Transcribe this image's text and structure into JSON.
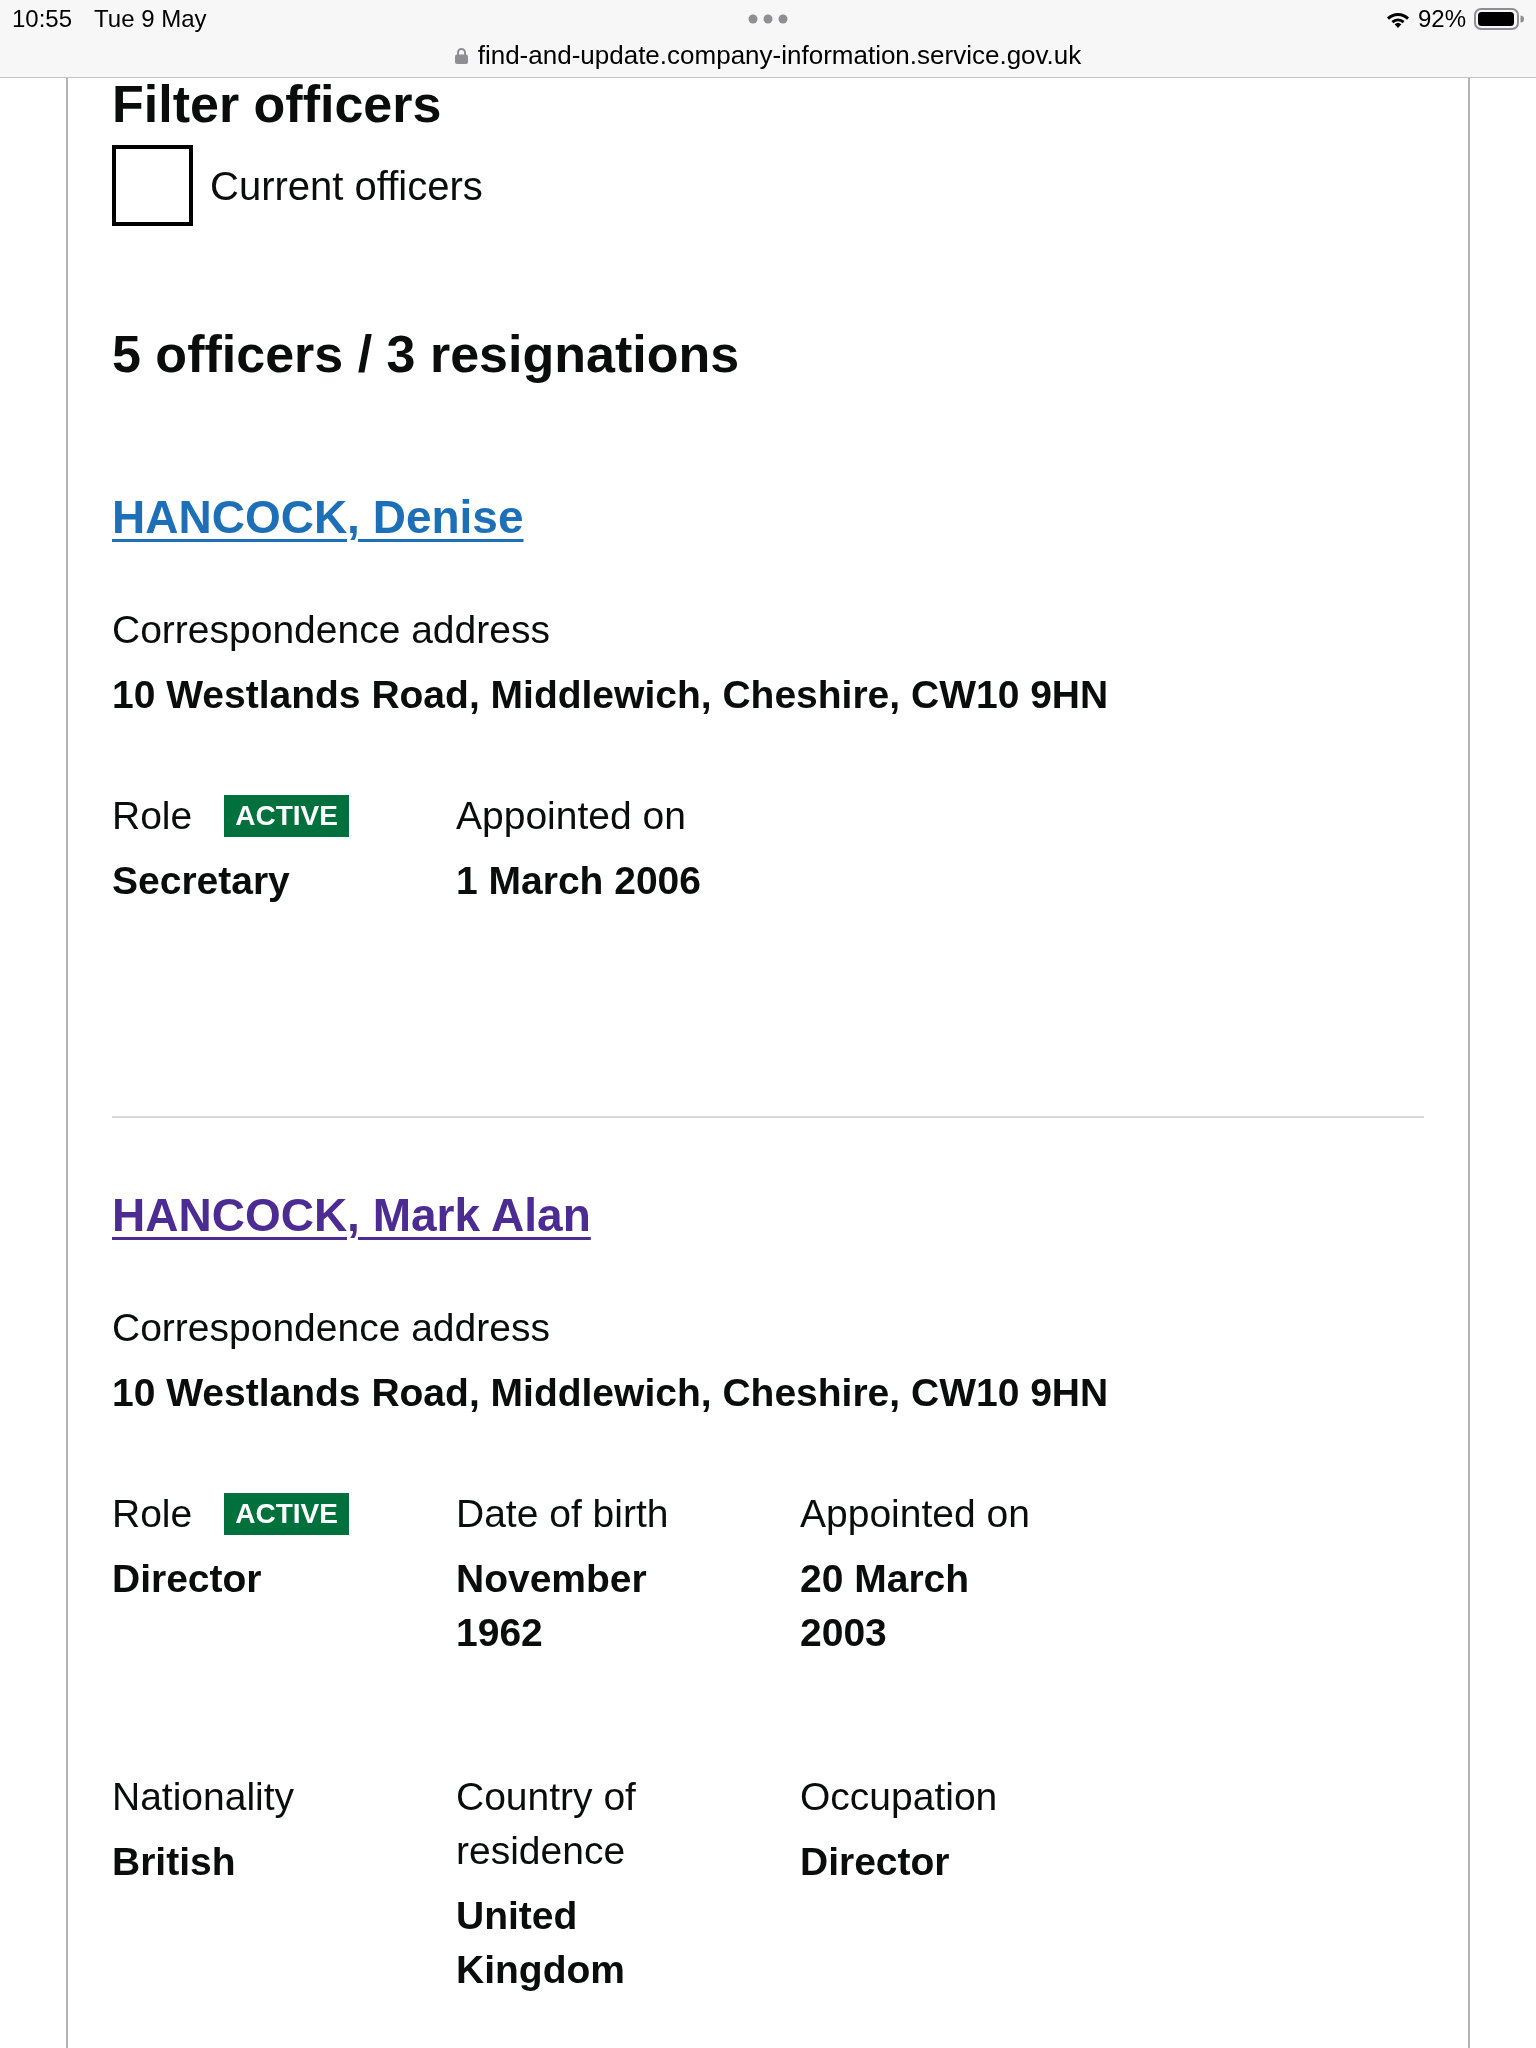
{
  "status_bar": {
    "time": "10:55",
    "date": "Tue 9 May",
    "url": "find-and-update.company-information.service.gov.uk",
    "battery": "92%"
  },
  "filter": {
    "heading": "Filter officers",
    "checkbox": {
      "label": "Current officers",
      "checked": false
    }
  },
  "summary": "5 officers / 3 resignations",
  "officers": [
    {
      "name": "HANCOCK, Denise",
      "visited": false,
      "address_label": "Correspondence address",
      "address": "10 Westlands Road, Middlewich, Cheshire, CW10 9HN",
      "rows": [
        [
          {
            "label": "Role",
            "badge": "ACTIVE",
            "value": "Secretary"
          },
          {
            "label": "Appointed on",
            "value": "1 March 2006"
          }
        ]
      ]
    },
    {
      "name": "HANCOCK, Mark Alan",
      "visited": true,
      "address_label": "Correspondence address",
      "address": "10 Westlands Road, Middlewich, Cheshire, CW10 9HN",
      "rows": [
        [
          {
            "label": "Role",
            "badge": "ACTIVE",
            "value": "Director"
          },
          {
            "label": "Date of birth",
            "value": "November 1962"
          },
          {
            "label": "Appointed on",
            "value": "20 March 2003"
          }
        ],
        [
          {
            "label": "Nationality",
            "value": "British"
          },
          {
            "label": "Country of residence",
            "value": "United Kingdom"
          },
          {
            "label": "Occupation",
            "value": "Director"
          }
        ]
      ]
    }
  ]
}
